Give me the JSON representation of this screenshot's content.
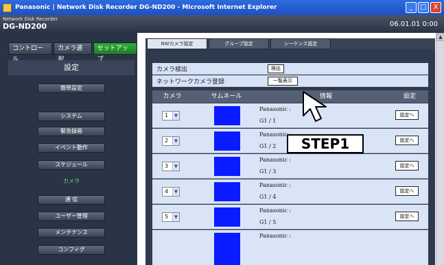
{
  "window": {
    "title": "Panasonic | Network Disk Recorder DG-ND200 - Microsoft Internet Explorer",
    "buttons": [
      "_",
      "□",
      "X"
    ]
  },
  "header": {
    "brand_small": "Network Disk Recorder",
    "model": "DG-ND200",
    "datetime": "06.01.01  0:00"
  },
  "topnav": [
    "コントロール",
    "カメラ選択",
    "セットアップ"
  ],
  "left": {
    "heading": "設定",
    "items": [
      "簡単設定",
      "システム",
      "緊急録画",
      "イベント動作",
      "スケジュール",
      "カメラ",
      "通 信",
      "ユーザー管理",
      "メンテナンス",
      "コンフィグ"
    ],
    "current_index": 5
  },
  "tabs": [
    "NWカメラ設定",
    "グループ設定",
    "シーケンス設定"
  ],
  "camera_detect": {
    "label": "カメラ検出",
    "button": "検出"
  },
  "camera_register": {
    "label": "ネットワークカメラ登録",
    "button": "一覧表示"
  },
  "table": {
    "headers": [
      "カメラ",
      "サムネール",
      "情報",
      "設定"
    ],
    "rows": [
      {
        "num": "1",
        "info1": "Panasonic :",
        "info2": "G1 / 1",
        "set": "設定へ"
      },
      {
        "num": "2",
        "info1": "Panasonic :",
        "info2": "G1 / 2",
        "set": "設定へ"
      },
      {
        "num": "3",
        "info1": "Panasonic :",
        "info2": "G1 / 3",
        "set": "設定へ"
      },
      {
        "num": "4",
        "info1": "Panasonic :",
        "info2": "G1 / 4",
        "set": "設定へ"
      },
      {
        "num": "5",
        "info1": "Panasonic :",
        "info2": "G1 / 5",
        "set": "設定へ"
      },
      {
        "num": "",
        "info1": "Panasonic :",
        "info2": "",
        "set": ""
      }
    ]
  },
  "step_label": "STEP1",
  "colors": {
    "accent": "#2fae3c",
    "thumb": "#0a1cff",
    "current_item": "#7fd26a"
  }
}
